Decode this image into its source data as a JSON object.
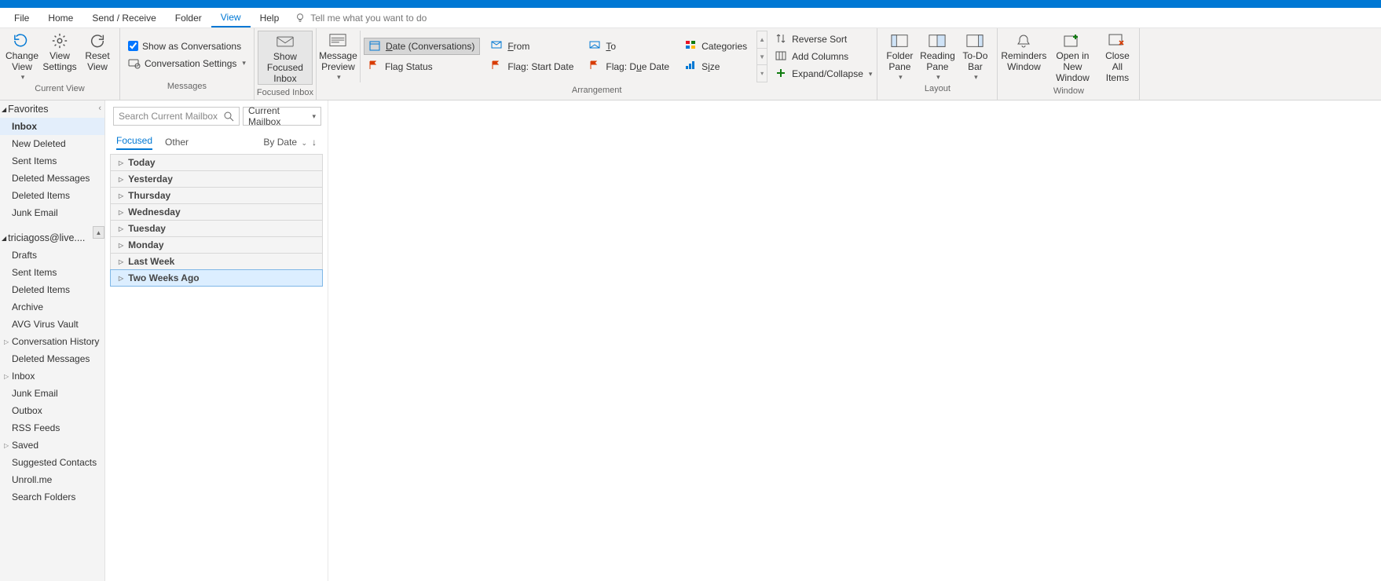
{
  "tabs": {
    "file": "File",
    "home": "Home",
    "sendrecv": "Send / Receive",
    "folder": "Folder",
    "view": "View",
    "help": "Help",
    "tellme": "Tell me what you want to do"
  },
  "ribbon": {
    "current_view": {
      "change": "Change View",
      "settings": "View Settings",
      "reset": "Reset View",
      "title": "Current View"
    },
    "messages": {
      "show_as_conv": "Show as Conversations",
      "conv_settings": "Conversation Settings",
      "title": "Messages"
    },
    "focused": {
      "btn": "Show Focused Inbox",
      "title": "Focused Inbox"
    },
    "msgprev": {
      "btn": "Message Preview"
    },
    "arrangement": {
      "date": "Date (Conversations)",
      "from": "From",
      "to": "To",
      "categories": "Categories",
      "flag_status": "Flag Status",
      "flag_start": "Flag: Start Date",
      "flag_due": "Flag: Due Date",
      "size": "Size",
      "reverse": "Reverse Sort",
      "add_cols": "Add Columns",
      "expand": "Expand/Collapse",
      "title": "Arrangement"
    },
    "layout": {
      "folder": "Folder Pane",
      "reading": "Reading Pane",
      "todo": "To-Do Bar",
      "title": "Layout"
    },
    "window": {
      "reminders": "Reminders Window",
      "open_new": "Open in New Window",
      "close_all": "Close All Items",
      "title": "Window"
    }
  },
  "folderpane": {
    "favorites_hdr": "Favorites",
    "favorites": [
      "Inbox",
      "New Deleted",
      "Sent Items",
      "Deleted Messages",
      "Deleted Items",
      "Junk Email"
    ],
    "account_hdr": "triciagoss@live....",
    "account_items": [
      {
        "label": "Drafts"
      },
      {
        "label": "Sent Items"
      },
      {
        "label": "Deleted Items"
      },
      {
        "label": "Archive"
      },
      {
        "label": "AVG Virus Vault"
      },
      {
        "label": "Conversation History",
        "exp": true
      },
      {
        "label": "Deleted Messages"
      },
      {
        "label": "Inbox",
        "exp": true
      },
      {
        "label": "Junk Email"
      },
      {
        "label": "Outbox"
      },
      {
        "label": "RSS Feeds"
      },
      {
        "label": "Saved",
        "exp": true
      },
      {
        "label": "Suggested Contacts"
      },
      {
        "label": "Unroll.me"
      },
      {
        "label": "Search Folders"
      }
    ]
  },
  "msglist": {
    "search_placeholder": "Search Current Mailbox",
    "scope": "Current Mailbox",
    "tab_focused": "Focused",
    "tab_other": "Other",
    "sort_by": "By Date",
    "groups": [
      "Today",
      "Yesterday",
      "Thursday",
      "Wednesday",
      "Tuesday",
      "Monday",
      "Last Week",
      "Two Weeks Ago"
    ],
    "selected_group": "Two Weeks Ago"
  }
}
